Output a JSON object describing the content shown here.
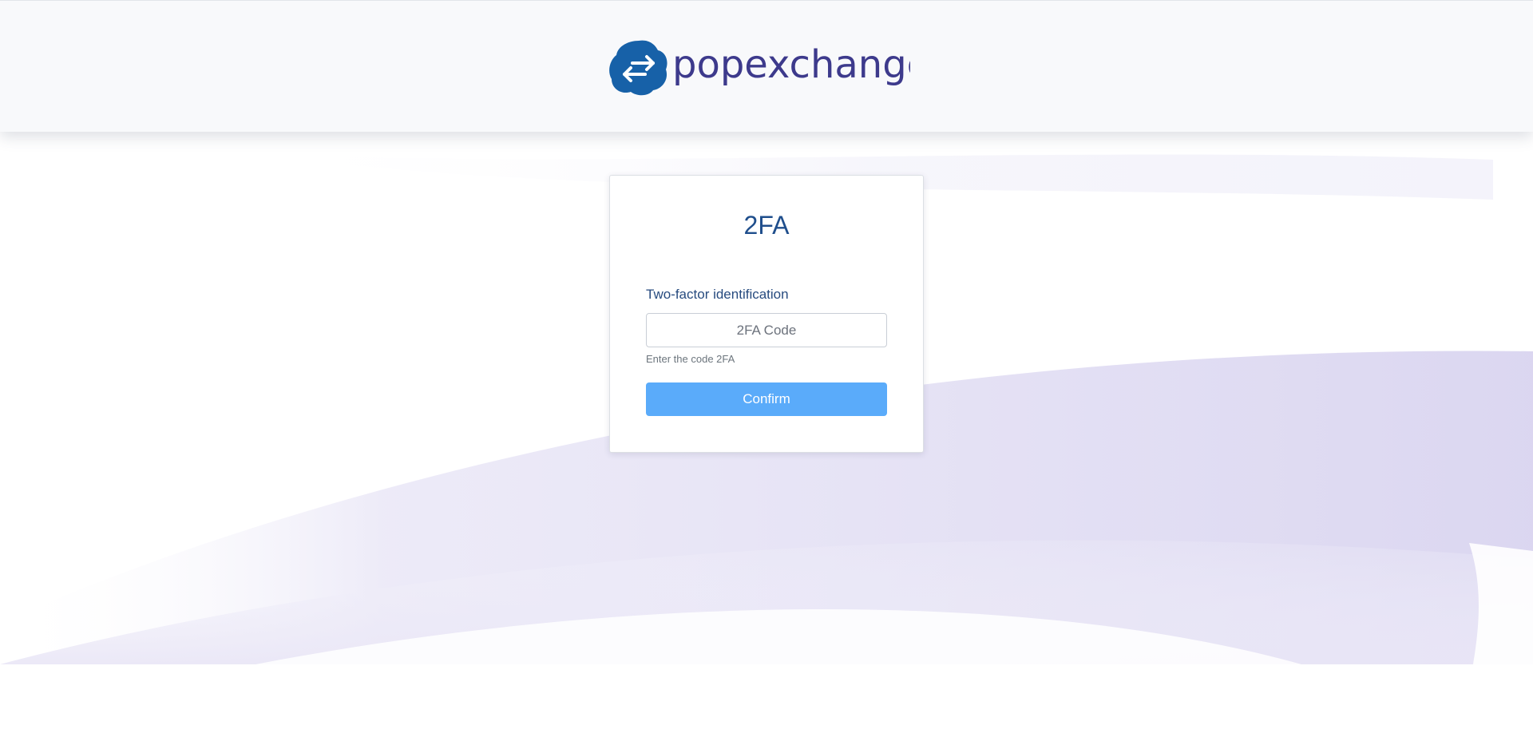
{
  "brand": {
    "name": "popexchange",
    "colors": {
      "blob": "#1761a8",
      "word_dark": "#3d3a8c",
      "word_accent": "#1f6cb0"
    }
  },
  "icons": {
    "logo_mark": "swap-arrows-icon"
  },
  "card": {
    "title": "2FA",
    "field_label": "Two-factor identification",
    "input": {
      "placeholder": "2FA Code",
      "value": ""
    },
    "help_text": "Enter the code 2FA",
    "confirm_label": "Confirm"
  },
  "colors": {
    "accent_button": "#5aabfa",
    "title_text": "#1f4e8c",
    "background_wave": "#e6e3f5"
  }
}
